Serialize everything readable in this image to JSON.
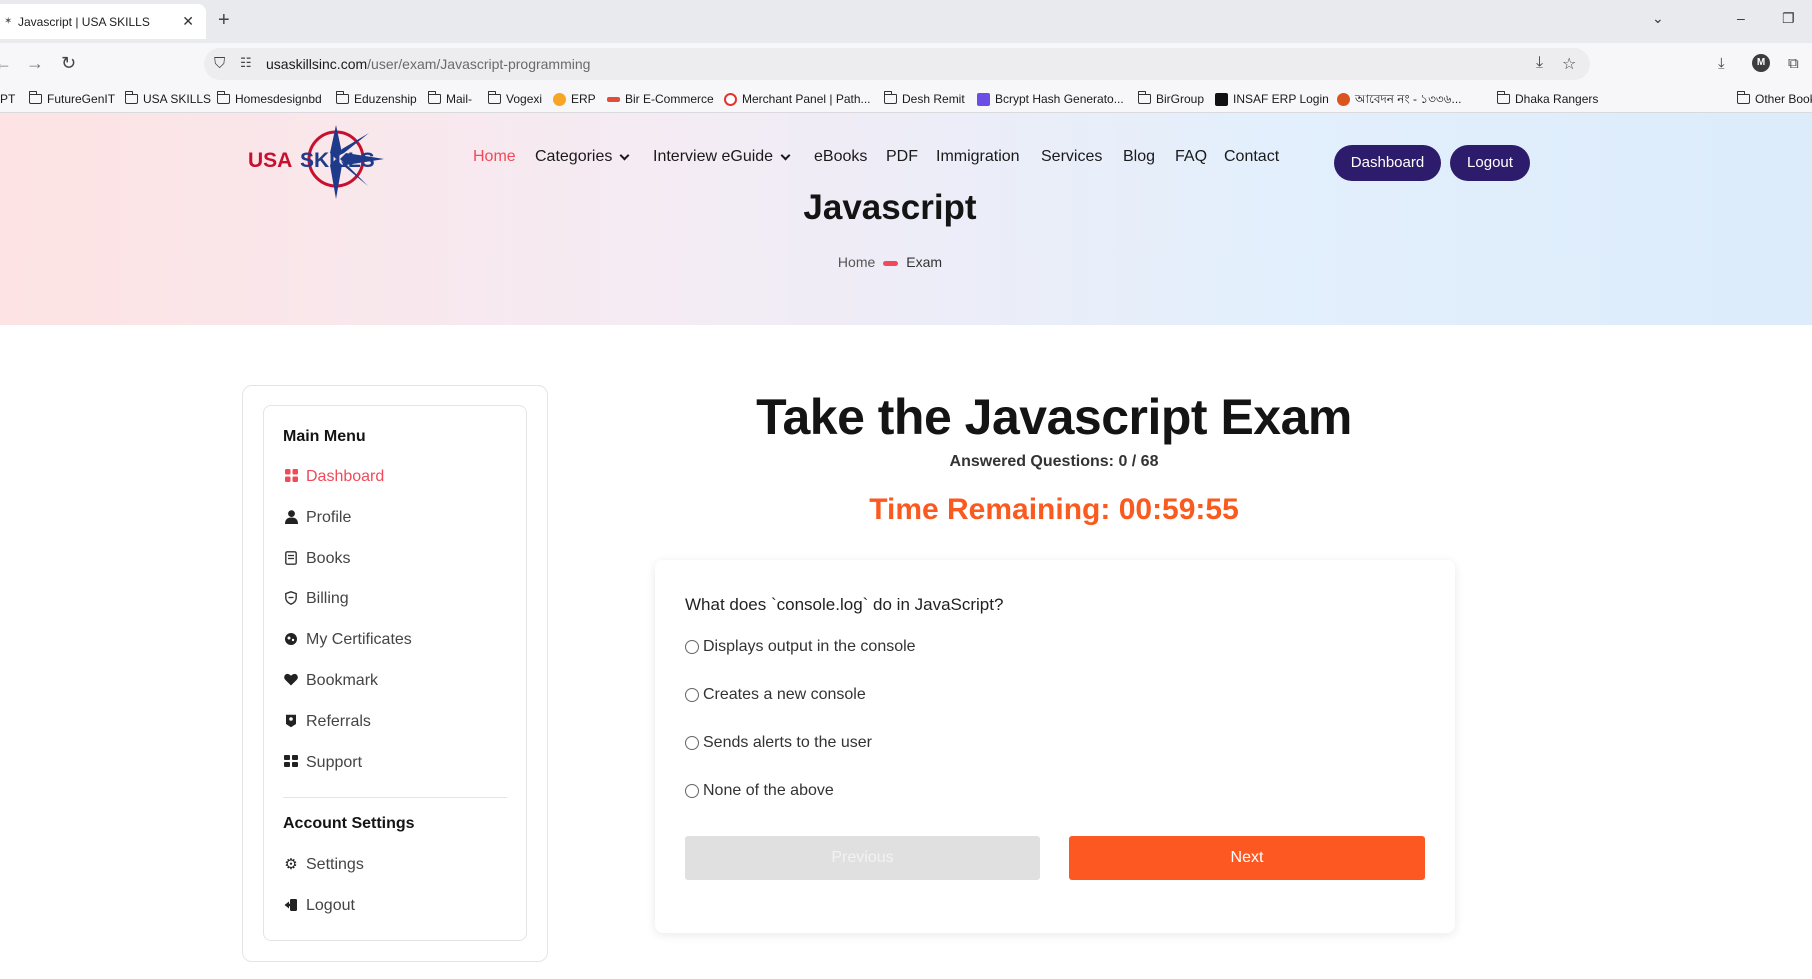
{
  "browser": {
    "tab_title": "Javascript | USA SKILLS",
    "url_host": "usaskillsinc.com",
    "url_path": "/user/exam/Javascript-programming",
    "bookmarks": [
      "SPT",
      "FutureGenIT",
      "USA SKILLS",
      "Homesdesignbd",
      "Eduzenship",
      "Mail-",
      "Vogexi",
      "ERP",
      "Bir E-Commerce",
      "Merchant Panel | Path...",
      "Desh Remit",
      "Bcrypt Hash Generato...",
      "BirGroup",
      "INSAF ERP Login",
      "আবেদন নং - ১৩৩৬...",
      "Dhaka Rangers",
      "Other Book"
    ]
  },
  "site": {
    "logo_text": "USA SKILLS",
    "nav": {
      "home": "Home",
      "categories": "Categories",
      "interview": "Interview eGuide",
      "ebooks": "eBooks",
      "pdf": "PDF",
      "immigration": "Immigration",
      "services": "Services",
      "blog": "Blog",
      "faq": "FAQ",
      "contact": "Contact"
    },
    "dashboard_btn": "Dashboard",
    "logout_btn": "Logout",
    "page_title": "Javascript",
    "breadcrumb": {
      "home": "Home",
      "current": "Exam"
    },
    "colors": {
      "accent": "#f04a5a",
      "brand": "#2d1b6b",
      "orange": "#fd5722"
    }
  },
  "sidebar": {
    "main_heading": "Main Menu",
    "items": [
      {
        "label": "Dashboard",
        "icon": "grid-icon"
      },
      {
        "label": "Profile",
        "icon": "user-icon"
      },
      {
        "label": "Books",
        "icon": "book-icon"
      },
      {
        "label": "Billing",
        "icon": "shield-icon"
      },
      {
        "label": "My Certificates",
        "icon": "certificate-icon"
      },
      {
        "label": "Bookmark",
        "icon": "heart-icon"
      },
      {
        "label": "Referrals",
        "icon": "referral-icon"
      },
      {
        "label": "Support",
        "icon": "support-icon"
      }
    ],
    "account_heading": "Account Settings",
    "account_items": [
      {
        "label": "Settings",
        "icon": "gear-icon"
      },
      {
        "label": "Logout",
        "icon": "logout-icon"
      }
    ]
  },
  "exam": {
    "title": "Take the Javascript Exam",
    "answered": "Answered Questions: 0 / 68",
    "timer": "Time Remaining: 00:59:55",
    "question": "What does `console.log` do in JavaScript?",
    "options": [
      "Displays output in the console",
      "Creates a new console",
      "Sends alerts to the user",
      "None of the above"
    ],
    "previous": "Previous",
    "next": "Next"
  }
}
